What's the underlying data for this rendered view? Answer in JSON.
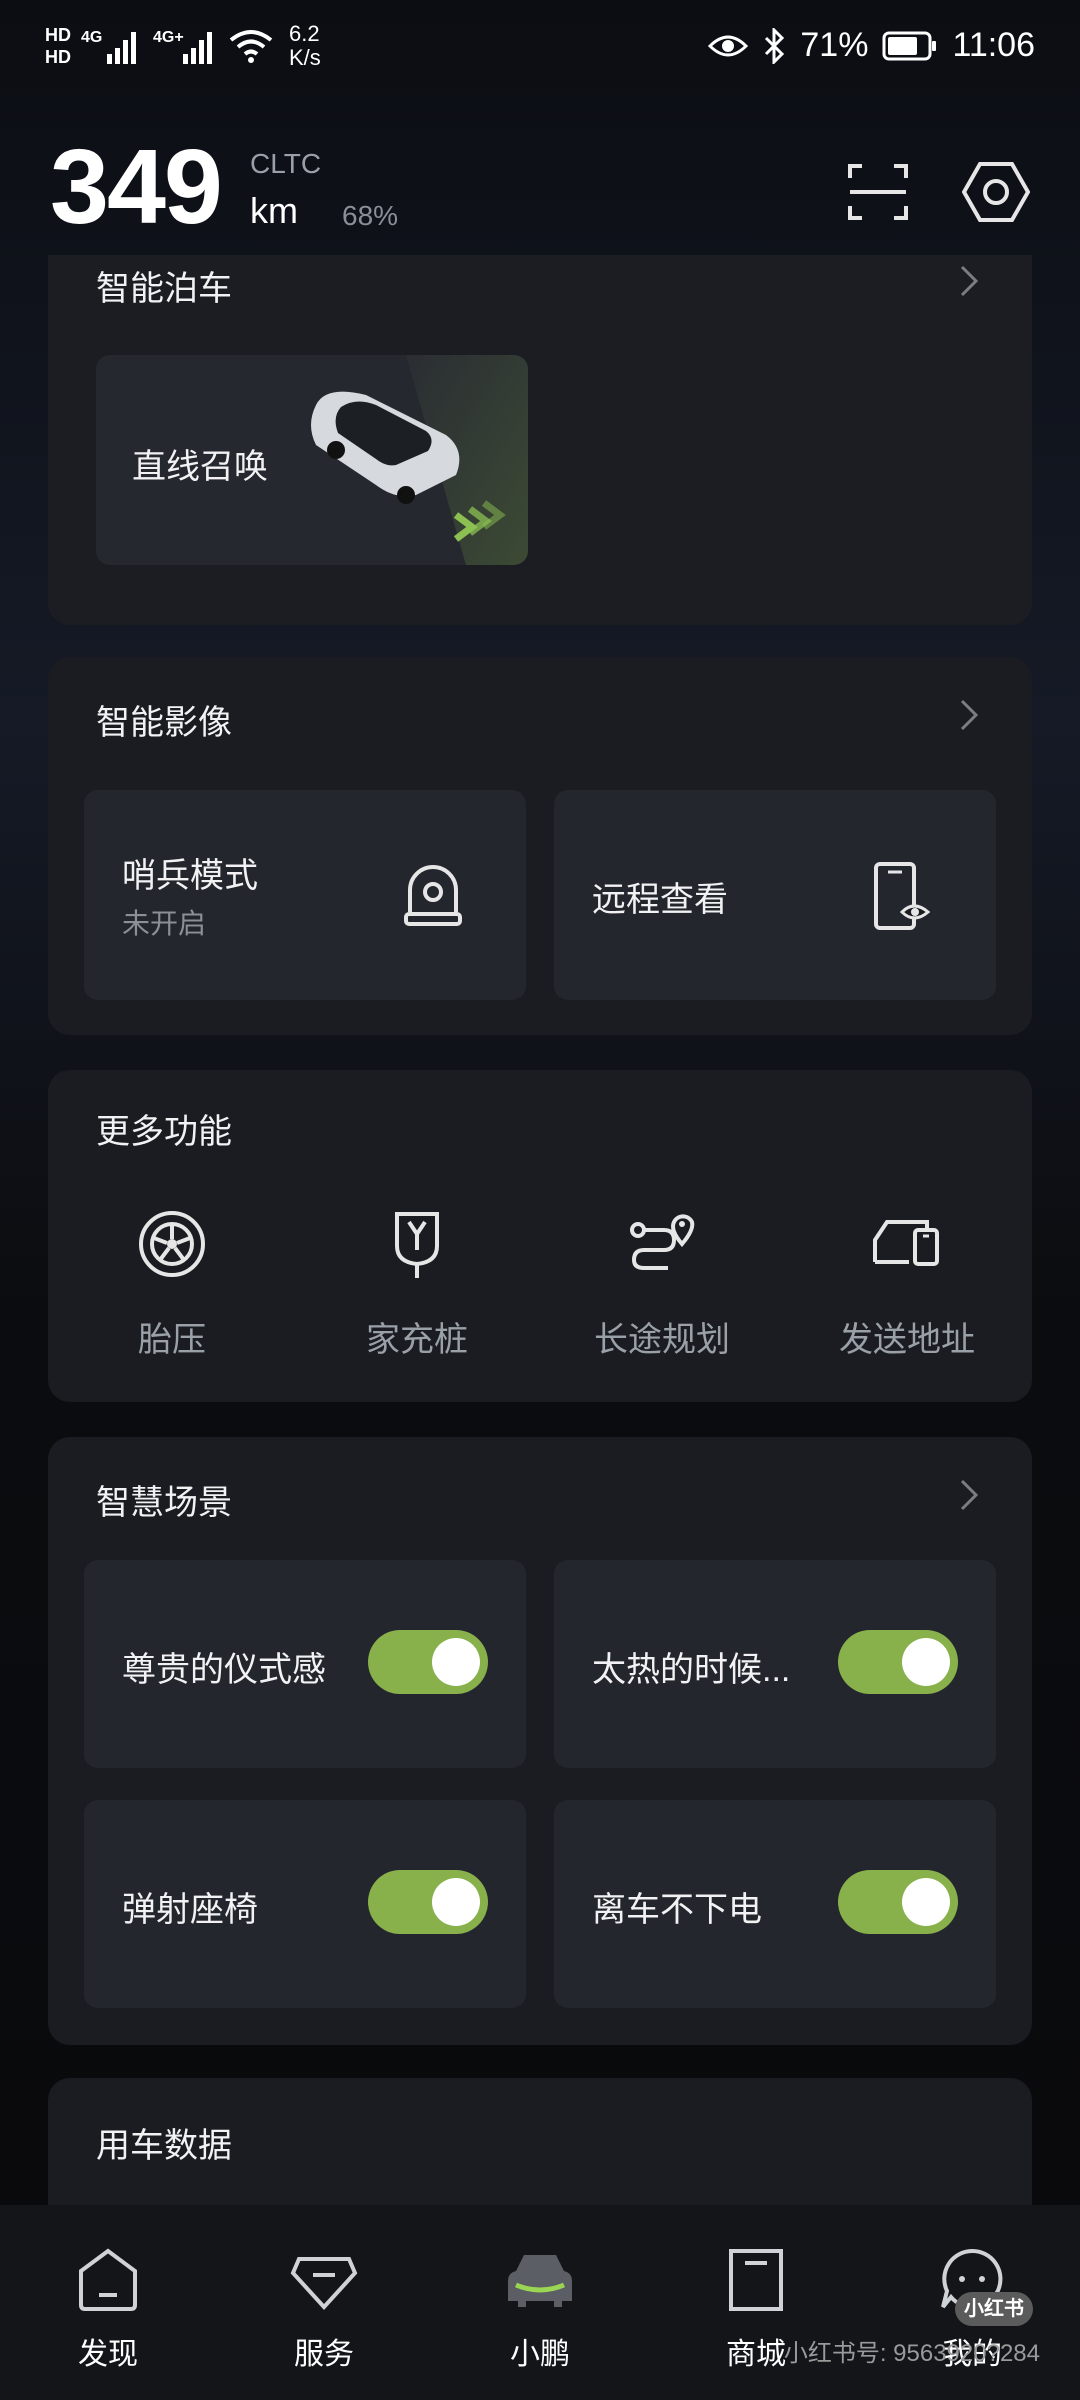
{
  "status_bar": {
    "net_speed_value": "6.2",
    "net_speed_unit": "K/s",
    "battery": "71%",
    "time": "11:06"
  },
  "header": {
    "range_value": "349",
    "range_standard": "CLTC",
    "range_unit": "km",
    "battery_percent": "68%"
  },
  "smart_parking": {
    "title": "智能泊车",
    "tile_label": "直线召唤"
  },
  "smart_video": {
    "title": "智能影像",
    "sentry_label": "哨兵模式",
    "sentry_status": "未开启",
    "remote_label": "远程查看"
  },
  "more_functions": {
    "title": "更多功能",
    "items": [
      {
        "label": "胎压",
        "icon": "tire-icon"
      },
      {
        "label": "家充桩",
        "icon": "charger-icon"
      },
      {
        "label": "长途规划",
        "icon": "route-icon"
      },
      {
        "label": "发送地址",
        "icon": "send-address-icon"
      }
    ]
  },
  "smart_scenes": {
    "title": "智慧场景",
    "items": [
      {
        "label": "尊贵的仪式感",
        "enabled": true
      },
      {
        "label": "太热的时候...",
        "enabled": true
      },
      {
        "label": "弹射座椅",
        "enabled": true
      },
      {
        "label": "离车不下电",
        "enabled": true
      }
    ]
  },
  "vehicle_data": {
    "title": "用车数据"
  },
  "bottom_nav": {
    "items": [
      {
        "label": "发现"
      },
      {
        "label": "服务"
      },
      {
        "label": "小鹏"
      },
      {
        "label": "商城"
      },
      {
        "label": "我的"
      }
    ],
    "active": "小鹏"
  },
  "watermark": {
    "badge": "小红书",
    "text": "小红书号: 9563920?284"
  },
  "colors": {
    "accent_green": "#88b04b",
    "card_bg": "#1a1c21",
    "tile_bg": "#23262c"
  }
}
